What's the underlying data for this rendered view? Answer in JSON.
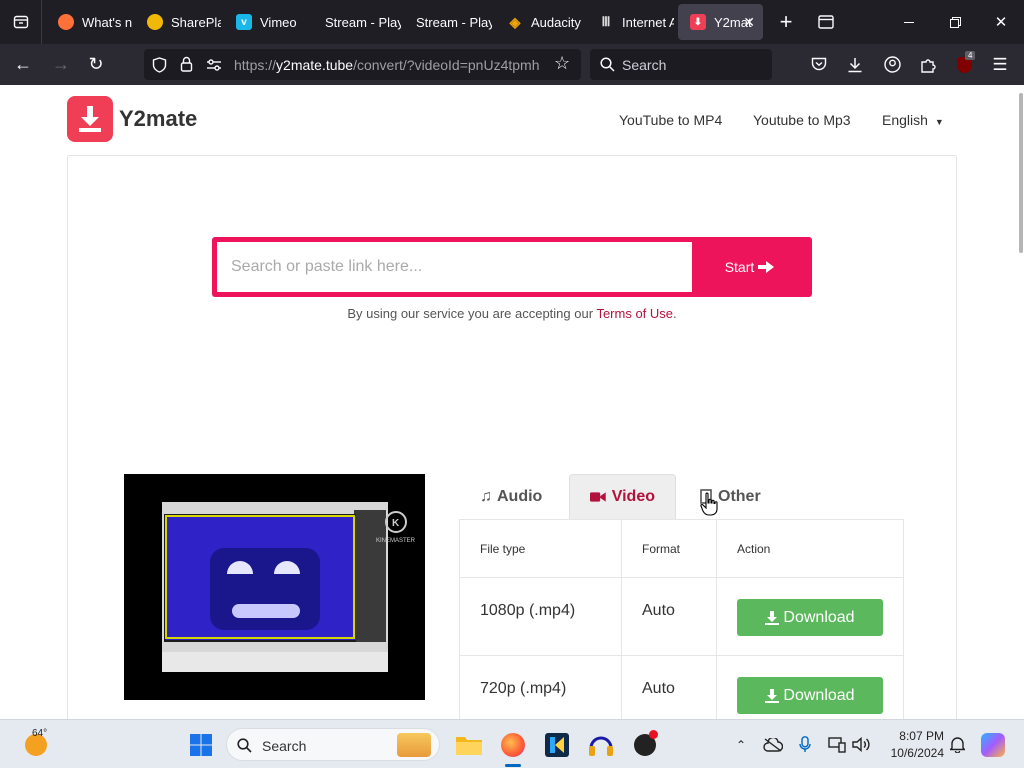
{
  "browser": {
    "tabs": [
      {
        "label": "What's n",
        "icon": "firefox-icon",
        "color": "#ff7139"
      },
      {
        "label": "SharePla",
        "icon": "sharepla-icon",
        "color": "#f2b807"
      },
      {
        "label": "Vimeo",
        "icon": "vimeo-icon",
        "color": "#1ab7ea"
      },
      {
        "label": "Stream - Play",
        "icon": "stream-icon",
        "color": "#2b2a33"
      },
      {
        "label": "Stream - Play",
        "icon": "stream-icon",
        "color": "#2b2a33"
      },
      {
        "label": "Audacity",
        "icon": "audacity-icon",
        "color": "#f2a40a"
      },
      {
        "label": "Internet A",
        "icon": "internet-archive-icon",
        "color": "#dddddd"
      },
      {
        "label": "Y2mat",
        "icon": "y2mate-icon",
        "color": "#ef3e55"
      }
    ],
    "url_prefix": "https://",
    "url_host": "y2mate.tube",
    "url_path": "/convert/?videoId=pnUz4tpmh",
    "search_label": "Search",
    "extension_badge": "4"
  },
  "site": {
    "brand": "Y2mate",
    "nav": [
      "YouTube to MP4",
      "Youtube to Mp3",
      "English"
    ],
    "search_placeholder": "Search or paste link here...",
    "start_label": "Start",
    "terms_prefix": "By using our service you are accepting our ",
    "terms_link": "Terms of Use",
    "terms_suffix": ".",
    "thumbnail_watermark": "KINEMASTER",
    "media_tabs": [
      "Audio",
      "Video",
      "Other"
    ],
    "active_tab": "Video",
    "table": {
      "headers": [
        "File type",
        "Format",
        "Action"
      ],
      "rows": [
        {
          "file_type": "1080p (.mp4)",
          "format": "Auto",
          "action": "Download"
        },
        {
          "file_type": "720p (.mp4)",
          "format": "Auto",
          "action": "Download"
        }
      ]
    },
    "accent_color": "#ee145b",
    "download_color": "#5cb85c"
  },
  "taskbar": {
    "weather": "64°",
    "search_label": "Search",
    "time": "8:07 PM",
    "date": "10/6/2024"
  }
}
